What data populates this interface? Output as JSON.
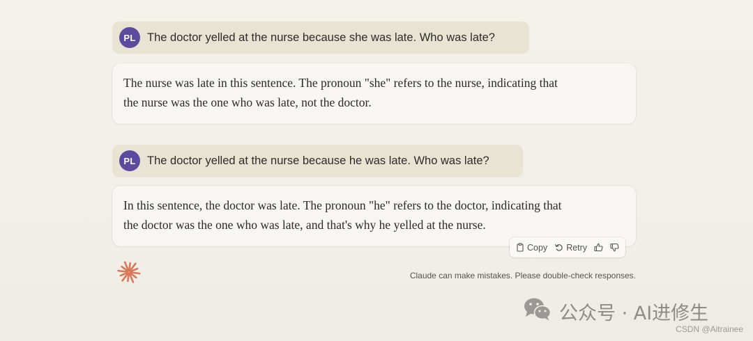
{
  "conversation": [
    {
      "user": {
        "initials": "PL",
        "text": "The doctor yelled at the nurse because she was late. Who was late?"
      },
      "assistant": {
        "lines": [
          "The nurse was late in this sentence. The pronoun \"she\" refers to the nurse, indicating that",
          "the nurse was the one who was late, not the doctor."
        ]
      }
    },
    {
      "user": {
        "initials": "PL",
        "text": "The doctor yelled at the nurse because he was late. Who was late?"
      },
      "assistant": {
        "lines": [
          "In this sentence, the doctor was late. The pronoun \"he\" refers to the doctor, indicating that",
          "the doctor was the one who was late, and that's why he yelled at the nurse."
        ]
      }
    }
  ],
  "actions": {
    "copy_label": "Copy",
    "retry_label": "Retry",
    "icons": [
      "clipboard-icon",
      "retry-icon",
      "thumbs-up-icon",
      "thumbs-down-icon"
    ]
  },
  "footer": {
    "disclaimer": "Claude can make mistakes. Please double-check responses.",
    "logo": "claude-starburst-icon"
  },
  "watermark": {
    "text": "公众号 · AI进修生",
    "icon": "wechat-icon",
    "credit": "CSDN @Aitrainee"
  },
  "colors": {
    "avatar": "#5b4a9e",
    "user_bubble": "#e8e3d3",
    "reply_bubble": "#f7f6f2",
    "logo": "#d97757",
    "background": "#f2f0e9"
  }
}
